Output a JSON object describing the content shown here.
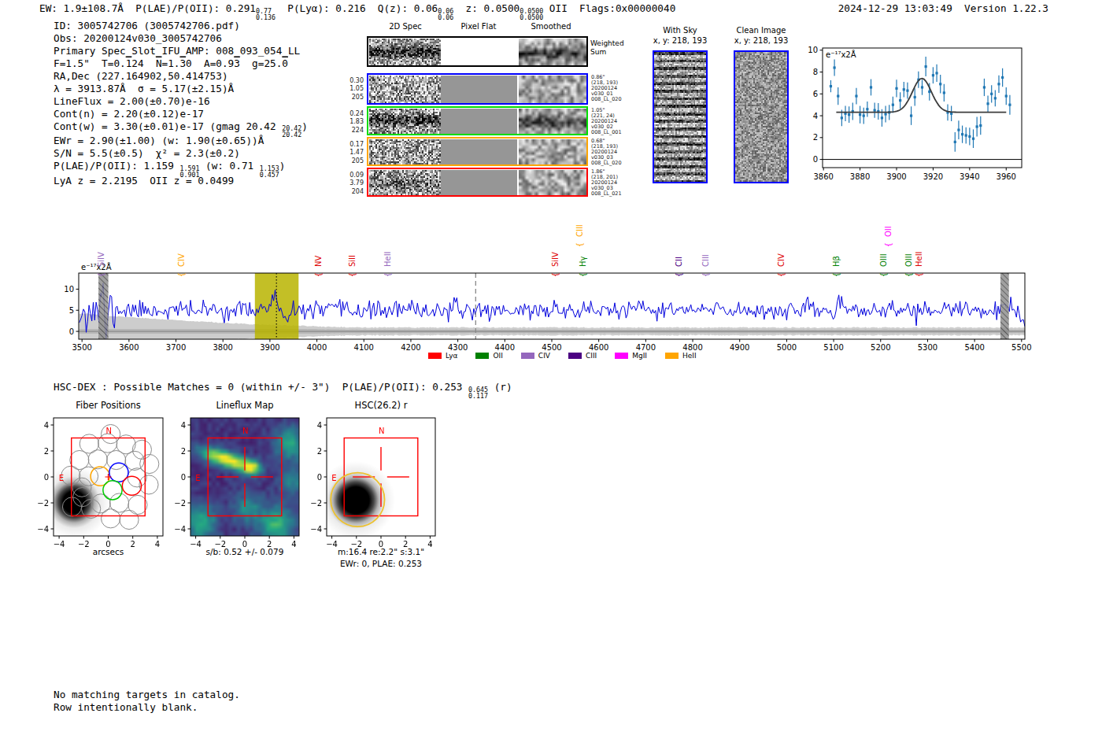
{
  "header": {
    "segments": [
      {
        "t": "EW: 1.9±108.7Å  P(LAE)/P(OII): 0.291"
      },
      {
        "frac": [
          "0.77",
          "0.136"
        ]
      },
      {
        "t": "  P(Lyα): 0.216  Q(z): 0.06"
      },
      {
        "frac": [
          "0.06",
          "0.06"
        ]
      },
      {
        "t": "  z: 0.0500"
      },
      {
        "frac": [
          "0.0500",
          "0.0500"
        ]
      },
      {
        "t": " OII  Flags:0x00000040"
      }
    ],
    "datetime": "2024-12-29 13:03:49",
    "version": "Version 1.22.3"
  },
  "info_lines": [
    [
      {
        "t": "ID: 3005742706 (3005742706.pdf)"
      }
    ],
    [
      {
        "t": "Obs: 20200124v030_3005742706"
      }
    ],
    [
      {
        "t": "Primary Spec_Slot_IFU_AMP: 008_093_054_LL"
      }
    ],
    [
      {
        "t": "F=1.5\"  T=0."
      },
      {
        "ov": "1"
      },
      {
        "t": "24  "
      },
      {
        "ov": "N"
      },
      {
        "t": "=1."
      },
      {
        "ov": "3"
      },
      {
        "t": "0  A=0.9"
      },
      {
        "ov": "3"
      },
      {
        "t": "  g=25."
      },
      {
        "ov": "0"
      }
    ],
    [
      {
        "t": "RA,Dec (227.164902,50.414753)"
      }
    ],
    [
      {
        "t": "λ = 3913.87Å  σ = 5.17(±2.15)Å"
      }
    ],
    [
      {
        "t": "LineFlux = 2.00(±0.70)e-16"
      }
    ],
    [
      {
        "t": "Cont(n) = 2.20(±0.12)e-17"
      }
    ],
    [
      {
        "t": "Cont(w) = 3.30(±0.01)e-17 (gmag 20.42 "
      },
      {
        "frac": [
          "20.42",
          "20.42"
        ]
      },
      {
        "t": ")"
      }
    ],
    [
      {
        "t": "EWr = 2.90(±1.00) (w: 1.90(±0.65))Å"
      }
    ],
    [
      {
        "t": "S/N = 5.5(±0.5)  χ² = 2.3(±0.2)"
      }
    ],
    [
      {
        "t": "P(LAE)/P(OII): 1.159 "
      },
      {
        "frac": [
          "1.591",
          "0.901"
        ]
      },
      {
        "t": " (w: 0.71 "
      },
      {
        "frac": [
          "1.153",
          "0.457"
        ]
      },
      {
        "t": ")"
      }
    ],
    [
      {
        "t": "LyA z = 2.2195  OII z = 0.0499"
      }
    ]
  ],
  "cutouts": {
    "col_titles": [
      "2D Spec",
      "Pixel Flat",
      "Smoothed"
    ],
    "weighted_label": [
      "Weighted",
      "Sum"
    ],
    "rows": [
      {
        "color": "#0000ff",
        "left": [
          "0.30",
          "1.05",
          "205"
        ],
        "right": [
          "0.86\"",
          "(218, 193)",
          "20200124",
          "v030_01",
          "008_LL_020"
        ]
      },
      {
        "color": "#00dd00",
        "left": [
          "0.24",
          "1.83",
          "224"
        ],
        "right": [
          "1.05\"",
          "(221, 24)",
          "20200124",
          "v030_02",
          "008_LL_001"
        ]
      },
      {
        "color": "#ffa500",
        "left": [
          "0.17",
          "1.47",
          "205"
        ],
        "right": [
          "0.68\"",
          "(218, 193)",
          "20200124",
          "v030_03",
          "008_LL_020"
        ]
      },
      {
        "color": "#ff0000",
        "left": [
          "0.09",
          "3.79",
          "204"
        ],
        "right": [
          "1.86\"",
          "(218, 201)",
          "20200124",
          "v030_03",
          "008_LL_021"
        ]
      }
    ]
  },
  "sky_panels": {
    "with_sky": {
      "title": "With Sky",
      "coords": "x, y: 218, 193"
    },
    "clean": {
      "title": "Clean Image",
      "coords": "x, y: 218, 193"
    },
    "border": "#0000ff"
  },
  "hsc_dex": [
    {
      "t": "HSC-DEX : Possible Matches = 0 (within +/- 3\")  P(LAE)/P(OII): 0.253 "
    },
    {
      "frac": [
        "0.645",
        "0.117"
      ]
    },
    {
      "t": " (r)"
    }
  ],
  "footer": [
    "No matching targets in catalog.",
    "Row intentionally blank."
  ],
  "legend": [
    {
      "label": "Lyα",
      "color": "#ff0000"
    },
    {
      "label": "OII",
      "color": "#008000"
    },
    {
      "label": "CIV",
      "color": "#9467bd"
    },
    {
      "label": "CIII",
      "color": "#4b0082"
    },
    {
      "label": "MgII",
      "color": "#ff00ff"
    },
    {
      "label": "HeII",
      "color": "#ffa500"
    }
  ],
  "chart_data": {
    "main_spectrum": {
      "type": "line",
      "unit_label": "e⁻¹⁷x2Å",
      "xlim": [
        3493,
        5507
      ],
      "ylim": [
        -1.85,
        13.8
      ],
      "xticks": [
        3500,
        3600,
        3700,
        3800,
        3900,
        4000,
        4100,
        4200,
        4300,
        4400,
        4500,
        4600,
        4700,
        4800,
        4900,
        5000,
        5100,
        5200,
        5300,
        5400,
        5500
      ],
      "yticks": [
        0,
        5,
        10
      ],
      "baseline": 5.0,
      "noise_sigma": 1.05,
      "seed": 11,
      "features": [
        {
          "x": 3910,
          "amp": 2.8,
          "sigma": 6
        },
        {
          "x": 3937,
          "amp": -2.9,
          "sigma": 7
        },
        {
          "x": 3880,
          "amp": 0.5,
          "sigma": 15
        },
        {
          "x": 3504,
          "amp": 7.5,
          "sigma": 1.5
        },
        {
          "x": 3509,
          "amp": -7.0,
          "sigma": 1.5
        },
        {
          "x": 3545,
          "amp": 4.0,
          "sigma": 2
        },
        {
          "x": 3552,
          "amp": -6.0,
          "sigma": 2
        },
        {
          "x": 5505,
          "amp": -2.5,
          "sigma": 8
        }
      ],
      "left_noise": {
        "until": 3570,
        "sigma": 2.6
      },
      "envelope": {
        "x": [
          3500,
          3560,
          3650,
          3750,
          3850,
          3950,
          4050,
          4150,
          5500
        ],
        "hw": [
          4.25,
          3.7,
          3.0,
          2.35,
          1.75,
          1.35,
          1.0,
          0.92,
          0.9
        ]
      },
      "highlight_band": {
        "x0": 3868,
        "x1": 3961,
        "color": "#b8b400"
      },
      "masked_bands": [
        {
          "x0": 3535,
          "x1": 3556
        },
        {
          "x0": 5455,
          "x1": 5473
        }
      ],
      "dotted_line_x": 3913.87,
      "dashed_line_x": 4338,
      "line_color": "#0000dd",
      "envelope_color": "#cdcdcd",
      "emission_labels": [
        {
          "x": 3540,
          "text": "SiIV",
          "color": "#9467bd",
          "tier": 0
        },
        {
          "x": 3711,
          "text": "CIV",
          "color": "#ffa500",
          "tier": 0
        },
        {
          "x": 4004,
          "text": "NV",
          "color": "#dd0000",
          "tier": 0
        },
        {
          "x": 4076,
          "text": "SiII",
          "color": "#dd0000",
          "tier": 0
        },
        {
          "x": 4150,
          "text": "HeII",
          "color": "#9467bd",
          "tier": 0
        },
        {
          "x": 4507,
          "text": "SiIV",
          "color": "#dd0000",
          "tier": 0
        },
        {
          "x": 4560,
          "text": "CIII",
          "color": "#ffa500",
          "tier": 1
        },
        {
          "x": 4567,
          "text": "Hγ",
          "color": "#008000",
          "tier": 0
        },
        {
          "x": 4771,
          "text": "CII",
          "color": "#4b0082",
          "tier": 0
        },
        {
          "x": 4828,
          "text": "CIII",
          "color": "#9467bd",
          "tier": 0
        },
        {
          "x": 4989,
          "text": "CIV",
          "color": "#dd0000",
          "tier": 0
        },
        {
          "x": 5106,
          "text": "Hβ",
          "color": "#008000",
          "tier": 0
        },
        {
          "x": 5207,
          "text": "OIII",
          "color": "#008000",
          "tier": 0
        },
        {
          "x": 5217,
          "text": "OII",
          "color": "#ff00ff",
          "tier": 1
        },
        {
          "x": 5260,
          "text": "OIII",
          "color": "#008000",
          "tier": 0
        },
        {
          "x": 5282,
          "text": "HeII",
          "color": "#dd0000",
          "tier": 0
        }
      ]
    },
    "zoom_spectrum": {
      "type": "scatter",
      "unit_label": "e⁻¹⁷x2Å",
      "x_start": 3864,
      "x_step": 2,
      "values": [
        6.7,
        8.4,
        5.8,
        3.8,
        4.2,
        4.1,
        4.4,
        5.8,
        4.1,
        4.0,
        4.6,
        6.6,
        4.5,
        4.4,
        3.8,
        4.15,
        4.3,
        5.0,
        6.5,
        5.4,
        6.4,
        6.3,
        4.0,
        5.7,
        7.3,
        6.6,
        8.5,
        6.2,
        7.7,
        7.9,
        6.9,
        6.1,
        4.3,
        4.2,
        1.6,
        2.7,
        2.3,
        2.2,
        2.1,
        1.9,
        3.0,
        3.1,
        6.6,
        5.1,
        6.0,
        5.6,
        6.9,
        7.5,
        5.8,
        5.0
      ],
      "errors": [
        0.55,
        0.75,
        0.8,
        0.75,
        0.7,
        0.75,
        0.8,
        0.75,
        0.8,
        0.75,
        0.7,
        0.75,
        0.7,
        0.75,
        0.8,
        0.75,
        0.7,
        0.75,
        0.8,
        0.75,
        0.7,
        0.75,
        0.85,
        0.8,
        0.75,
        0.7,
        0.9,
        0.8,
        0.75,
        0.8,
        0.85,
        0.8,
        0.75,
        0.7,
        0.9,
        0.85,
        0.8,
        0.75,
        0.8,
        0.85,
        0.9,
        0.85,
        0.8,
        0.75,
        0.8,
        0.75,
        0.8,
        0.85,
        0.8,
        0.9
      ],
      "fit": {
        "center": 3913.87,
        "sigma": 5.17,
        "amplitude": 3.1,
        "baseline": 4.32
      },
      "xticks": [
        3860,
        3880,
        3900,
        3920,
        3940,
        3960
      ],
      "yticks": [
        0,
        2,
        4,
        6,
        8,
        10
      ],
      "xlim": [
        3859.5,
        3968.5
      ],
      "ylim": [
        -0.75,
        10.2
      ],
      "point_color": "#1f77b4",
      "fit_color": "#3c3c3c"
    },
    "fiber_positions": {
      "title": "Fiber Positions",
      "xlabel": "arcsecs",
      "ticks": [
        -4,
        -2,
        0,
        2,
        4
      ],
      "fiber_radius": 0.76,
      "fibers_gray": [
        [
          0.2,
          3.3
        ],
        [
          -1.55,
          2.55
        ],
        [
          -0.05,
          2.6
        ],
        [
          1.45,
          2.5
        ],
        [
          2.75,
          2.1
        ],
        [
          -2.35,
          1.3
        ],
        [
          -0.85,
          1.35
        ],
        [
          0.65,
          1.3
        ],
        [
          2.15,
          1.25
        ],
        [
          3.35,
          1.0
        ],
        [
          -3.05,
          0.1
        ],
        [
          -1.6,
          0.05
        ],
        [
          2.35,
          -0.05
        ],
        [
          3.3,
          -0.6
        ],
        [
          -2.15,
          -0.8
        ],
        [
          -0.6,
          -2.05
        ],
        [
          0.9,
          -2.0
        ],
        [
          2.4,
          -2.15
        ],
        [
          -2.1,
          -1.55
        ],
        [
          -2.95,
          -2.3
        ],
        [
          -1.4,
          -2.45
        ],
        [
          0.2,
          -3.2
        ],
        [
          1.7,
          -3.3
        ]
      ],
      "fibers_colored": [
        {
          "x": -0.66,
          "y": 0.05,
          "color": "#ffa500"
        },
        {
          "x": 0.86,
          "y": 0.35,
          "color": "#0000ff"
        },
        {
          "x": 0.35,
          "y": -1.02,
          "color": "#00cc00"
        },
        {
          "x": 1.92,
          "y": -0.68,
          "color": "#ff0000"
        }
      ],
      "square": [
        -3,
        3
      ],
      "blob": {
        "x": -2.78,
        "y": -1.95
      },
      "compass": {
        "n": "N",
        "e": "E"
      }
    },
    "lineflux_map": {
      "title": "Lineflux Map",
      "caption": "s/b: 0.52 +/- 0.079",
      "ticks": [
        -4,
        -2,
        0,
        2,
        4
      ],
      "square": [
        -3,
        3
      ],
      "seed": 5,
      "blobs": [
        {
          "x": -2.1,
          "y": 1.5,
          "amp": 0.9,
          "sx": 1.2,
          "sy": 0.4,
          "rot": -0.3
        },
        {
          "x": 0.55,
          "y": 0.7,
          "amp": 0.95,
          "sx": 0.55,
          "sy": 0.4,
          "rot": 0
        },
        {
          "x": -0.8,
          "y": 1.15,
          "amp": 0.5,
          "sx": 0.75,
          "sy": 0.4,
          "rot": -0.3
        },
        {
          "x": 2.6,
          "y": -3.6,
          "amp": 0.6,
          "sx": 1.0,
          "sy": 1.0,
          "rot": 0
        },
        {
          "x": -3.6,
          "y": -3.4,
          "amp": 0.55,
          "sx": 0.9,
          "sy": 0.9,
          "rot": 0
        },
        {
          "x": 3.7,
          "y": 2.5,
          "amp": 0.5,
          "sx": 0.9,
          "sy": 0.9,
          "rot": 0
        },
        {
          "x": 0.2,
          "y": -2.4,
          "amp": 0.4,
          "sx": 0.8,
          "sy": 0.8,
          "rot": 0
        },
        {
          "x": 3.9,
          "y": -0.4,
          "amp": 0.35,
          "sx": 0.7,
          "sy": 0.7,
          "rot": 0
        }
      ],
      "compass": {
        "n": "N",
        "e": "E"
      }
    },
    "hsc_image": {
      "title": "HSC(26.2) r",
      "captions": [
        "m:16.4 re:2.2\" s:3.1\"",
        "EWr: 0, PLAE: 0.253"
      ],
      "ticks": [
        -4,
        -2,
        0,
        2,
        4
      ],
      "square": [
        -3,
        3
      ],
      "blob": {
        "x": -2.05,
        "y": -1.8
      },
      "aperture": {
        "x": -1.9,
        "y": -1.75,
        "r": 2.15,
        "color": "#edc22e"
      },
      "compass": {
        "n": "N",
        "e": "E"
      }
    }
  }
}
